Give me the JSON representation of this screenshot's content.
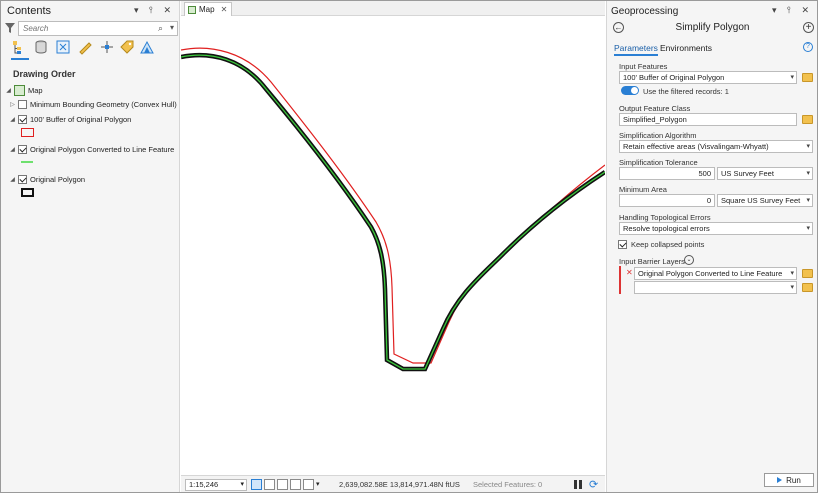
{
  "contents": {
    "title": "Contents",
    "window_controls": "▾ ⫯ ✕",
    "search_placeholder": "Search",
    "drawing_order_label": "Drawing Order",
    "layers": [
      {
        "name": "Map",
        "kind": "map"
      },
      {
        "name": "Minimum Bounding Geometry (Convex Hull)",
        "checked": false
      },
      {
        "name": "100' Buffer of Original Polygon",
        "checked": true,
        "symbol": "polygon-red-outline"
      },
      {
        "name": "Original Polygon Converted to Line Feature",
        "checked": true,
        "symbol": "line-green"
      },
      {
        "name": "Original Polygon",
        "checked": true,
        "symbol": "polygon-black-outline"
      }
    ]
  },
  "map": {
    "tab_label": "Map",
    "scale": "1:15,246",
    "coordinates": "2,639,082.58E 13,814,971.48N ftUS",
    "selected_features": "Selected Features: 0",
    "colors": {
      "buffer": "#e02020",
      "line": "#3cc83c",
      "polygon": "#111111"
    }
  },
  "geoprocessing": {
    "title": "Geoprocessing",
    "window_controls": "▾ ⫯ ✕",
    "tool_name": "Simplify Polygon",
    "tabs": [
      "Parameters",
      "Environments"
    ],
    "params": {
      "input_features_label": "Input Features",
      "input_features_value": "100' Buffer of Original Polygon",
      "use_filtered_label": "Use the filtered records: 1",
      "output_class_label": "Output Feature Class",
      "output_class_value": "Simplified_Polygon",
      "algorithm_label": "Simplification Algorithm",
      "algorithm_value": "Retain effective areas (Visvalingam-Whyatt)",
      "tolerance_label": "Simplification Tolerance",
      "tolerance_value": "500",
      "tolerance_unit": "US Survey Feet",
      "min_area_label": "Minimum Area",
      "min_area_value": "0",
      "min_area_unit": "Square US Survey Feet",
      "topo_label": "Handling Topological Errors",
      "topo_value": "Resolve topological errors",
      "keep_collapsed_label": "Keep collapsed points",
      "barrier_label": "Input Barrier Layers",
      "barrier_value": "Original Polygon Converted to Line Feature",
      "barrier_empty": ""
    },
    "run_label": "Run"
  }
}
